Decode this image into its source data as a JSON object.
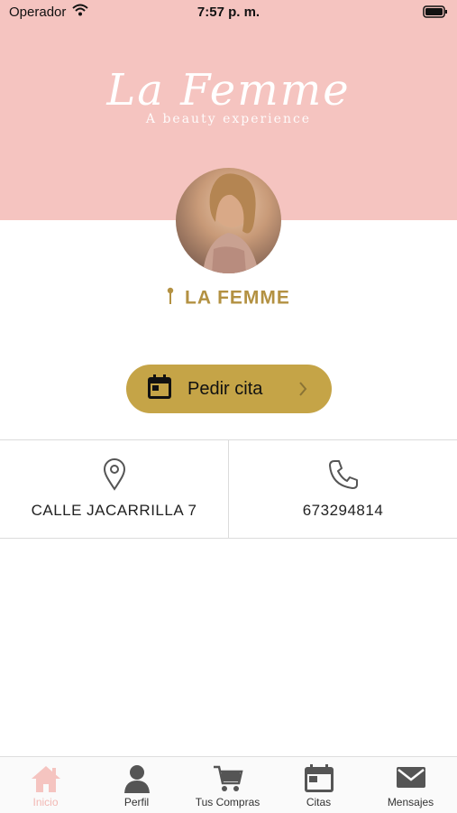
{
  "status_bar": {
    "carrier": "Operador",
    "time": "7:57 p. m."
  },
  "header": {
    "logo_script": "La Femme",
    "tagline": "A beauty experience"
  },
  "shop": {
    "name": "LA FEMME"
  },
  "booking": {
    "button_label": "Pedir cita"
  },
  "info": {
    "address": "CALLE JACARRILLA 7",
    "phone": "673294814"
  },
  "tabs": [
    {
      "label": "Inicio",
      "icon": "home-icon",
      "active": true
    },
    {
      "label": "Perfil",
      "icon": "person-icon",
      "active": false
    },
    {
      "label": "Tus Compras",
      "icon": "cart-icon",
      "active": false
    },
    {
      "label": "Citas",
      "icon": "calendar-icon",
      "active": false
    },
    {
      "label": "Mensajes",
      "icon": "mail-icon",
      "active": false
    }
  ],
  "colors": {
    "header_pink": "#f5c4c0",
    "gold": "#c5a447",
    "gold_text": "#b39142",
    "active_tab": "#f2b8b4",
    "icon_gray": "#555555"
  }
}
